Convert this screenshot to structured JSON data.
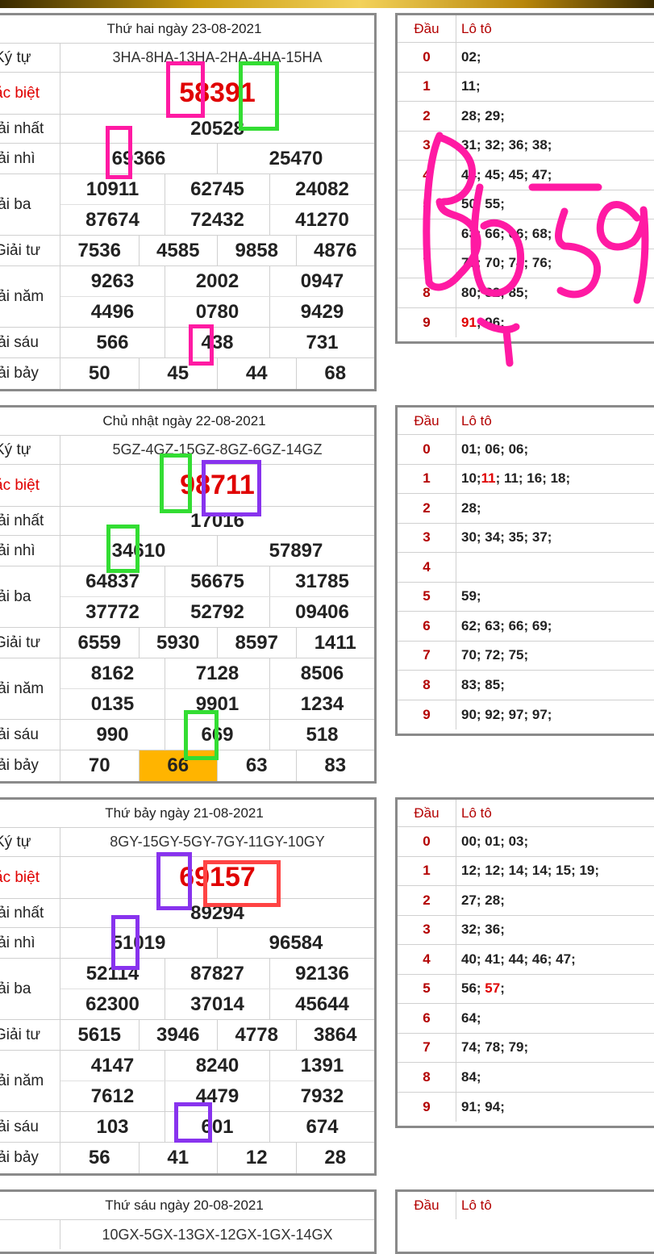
{
  "top_bar": {
    "color": "#c89a10"
  },
  "accent": {
    "special": "#e00000",
    "dau": "#b30000",
    "highlight": "#ffb400"
  },
  "results": [
    {
      "date": "Thứ hai ngày 23-08-2021",
      "labels": {
        "codes": "Ký tự",
        "special": "ặc biệt",
        "first": "iải nhất",
        "second": "iải nhì",
        "third": "iải ba",
        "fourth": "Giải tư",
        "fifth": "iải năm",
        "sixth": "iải sáu",
        "seventh": "iải bảy"
      },
      "codes": "3HA-8HA-13HA-2HA-4HA-15HA",
      "special": "58391",
      "first": "20528",
      "second": [
        "69366",
        "25470"
      ],
      "third": [
        "10911",
        "62745",
        "24082",
        "87674",
        "72432",
        "41270"
      ],
      "fourth": [
        "7536",
        "4585",
        "9858",
        "4876"
      ],
      "fifth": [
        "9263",
        "2002",
        "0947",
        "4496",
        "0780",
        "9429"
      ],
      "sixth": [
        "566",
        "438",
        "731"
      ],
      "seventh": [
        "50",
        "45",
        "44",
        "68"
      ]
    },
    {
      "date": "Chủ nhật ngày 22-08-2021",
      "labels": {
        "codes": "Ký tự",
        "special": "ặc biệt",
        "first": "iải nhất",
        "second": "iải nhì",
        "third": "iải ba",
        "fourth": "Giải tư",
        "fifth": "iải năm",
        "sixth": "iải sáu",
        "seventh": "iải bảy"
      },
      "codes": "5GZ-4GZ-15GZ-8GZ-6GZ-14GZ",
      "special": "98711",
      "first": "17016",
      "second": [
        "34610",
        "57897"
      ],
      "third": [
        "64837",
        "56675",
        "31785",
        "37772",
        "52792",
        "09406"
      ],
      "fourth": [
        "6559",
        "5930",
        "8597",
        "1411"
      ],
      "fifth": [
        "8162",
        "7128",
        "8506",
        "0135",
        "9901",
        "1234"
      ],
      "sixth": [
        "990",
        "669",
        "518"
      ],
      "seventh": [
        "70",
        "66",
        "63",
        "83"
      ]
    },
    {
      "date": "Thứ bảy ngày 21-08-2021",
      "labels": {
        "codes": "Ký tự",
        "special": "ặc biệt",
        "first": "iải nhất",
        "second": "iải nhì",
        "third": "iải ba",
        "fourth": "Giải tư",
        "fifth": "iải năm",
        "sixth": "iải sáu",
        "seventh": "iải bảy"
      },
      "codes": "8GY-15GY-5GY-7GY-11GY-10GY",
      "special": "69157",
      "first": "89294",
      "second": [
        "51019",
        "96584"
      ],
      "third": [
        "52114",
        "87827",
        "92136",
        "62300",
        "37014",
        "45644"
      ],
      "fourth": [
        "5615",
        "3946",
        "4778",
        "3864"
      ],
      "fifth": [
        "4147",
        "8240",
        "1391",
        "7612",
        "4479",
        "7932"
      ],
      "sixth": [
        "103",
        "601",
        "674"
      ],
      "seventh": [
        "56",
        "41",
        "12",
        "28"
      ]
    },
    {
      "date": "Thứ sáu ngày 20-08-2021",
      "codes": "10GX-5GX-13GX-12GX-1GX-14GX"
    }
  ],
  "lotos": [
    {
      "header": {
        "dau": "Đầu",
        "loto": "Lô tô"
      },
      "rows": [
        {
          "d": "0",
          "v": "02;"
        },
        {
          "d": "1",
          "v": "11;"
        },
        {
          "d": "2",
          "v": "28; 29;"
        },
        {
          "d": "3",
          "v": "31; 32; 36; 38;"
        },
        {
          "d": "4",
          "v": "44; 45; 45; 47;"
        },
        {
          "d": "5",
          "v": "50; 55;"
        },
        {
          "d": "6",
          "v": "63; 66; 66; 68;"
        },
        {
          "d": "7",
          "v": "70; 70; 74; 76;"
        },
        {
          "d": "8",
          "v": "80; 82; 85;"
        },
        {
          "d": "9",
          "v_red": "91",
          "v": "; 96;"
        }
      ]
    },
    {
      "header": {
        "dau": "Đầu",
        "loto": "Lô tô"
      },
      "rows": [
        {
          "d": "0",
          "v": "01; 06; 06;"
        },
        {
          "d": "1",
          "v_pre": "10; ",
          "v_red": "11",
          "v": "; 11; 16; 18;"
        },
        {
          "d": "2",
          "v": "28;"
        },
        {
          "d": "3",
          "v": "30; 34; 35; 37;"
        },
        {
          "d": "4",
          "v": ""
        },
        {
          "d": "5",
          "v": "59;"
        },
        {
          "d": "6",
          "v": "62; 63; 66; 69;"
        },
        {
          "d": "7",
          "v": "70; 72; 75;"
        },
        {
          "d": "8",
          "v": "83; 85;"
        },
        {
          "d": "9",
          "v": "90; 92; 97; 97;"
        }
      ]
    },
    {
      "header": {
        "dau": "Đầu",
        "loto": "Lô tô"
      },
      "rows": [
        {
          "d": "0",
          "v": "00; 01; 03;"
        },
        {
          "d": "1",
          "v": "12; 12; 14; 14; 15; 19;"
        },
        {
          "d": "2",
          "v": "27; 28;"
        },
        {
          "d": "3",
          "v": "32; 36;"
        },
        {
          "d": "4",
          "v": "40; 41; 44; 46; 47;"
        },
        {
          "d": "5",
          "v_pre": "56; ",
          "v_red": "57",
          "v": ";"
        },
        {
          "d": "6",
          "v": "64;"
        },
        {
          "d": "7",
          "v": "74; 78; 79;"
        },
        {
          "d": "8",
          "v": "84;"
        },
        {
          "d": "9",
          "v": "91; 94;"
        }
      ]
    },
    {
      "header": {
        "dau": "Đầu",
        "loto": "Lô tô"
      }
    }
  ],
  "annotation": {
    "handwriting": "Bo 59",
    "pen_color": "#ff1aa3"
  }
}
